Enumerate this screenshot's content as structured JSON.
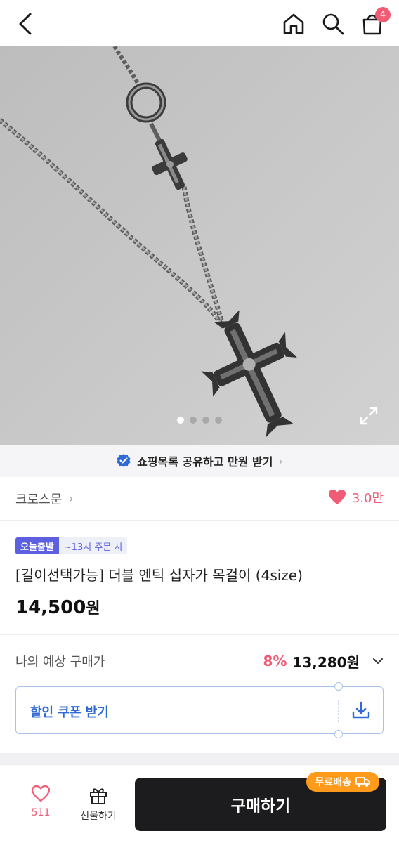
{
  "header": {
    "back_icon": "chevron-left-icon",
    "home_icon": "home-icon",
    "search_icon": "search-icon",
    "cart_icon": "shopping-bag-icon",
    "cart_count": "4"
  },
  "gallery": {
    "dot_count": 4,
    "active_index": 0,
    "expand_icon": "expand-icon"
  },
  "share_banner": {
    "icon": "verified-check-icon",
    "text": "쇼핑목록 공유하고 만원 받기",
    "chevron": "›"
  },
  "brand": {
    "name": "크로스문",
    "chevron": "›",
    "like_icon": "heart-filled-icon",
    "like_count": "3.0만"
  },
  "product": {
    "badge_today": "오늘출발",
    "badge_time": "~13시 주문 시",
    "title": "[길이선택가능] 더블 엔틱 십자가 목걸이 (4size)",
    "price": "14,500",
    "currency": "원"
  },
  "expected_price": {
    "label": "나의 예상 구매가",
    "discount_rate": "8%",
    "price": "13,280원"
  },
  "coupon": {
    "label": "할인 쿠폰 받기",
    "icon": "download-icon"
  },
  "bottom_bar": {
    "wish_icon": "heart-outline-icon",
    "wish_count": "511",
    "gift_icon": "gift-icon",
    "gift_label": "선물하기",
    "buy_label": "구매하기",
    "shipping_badge": "무료배송",
    "shipping_icon": "truck-icon"
  },
  "colors": {
    "accent_pink": "#f15c75",
    "today_badge": "#5b5fe0",
    "coupon_blue": "#2f6bd6",
    "buy_button": "#1c1c1e",
    "shipping_orange": "#ff9a1a"
  }
}
